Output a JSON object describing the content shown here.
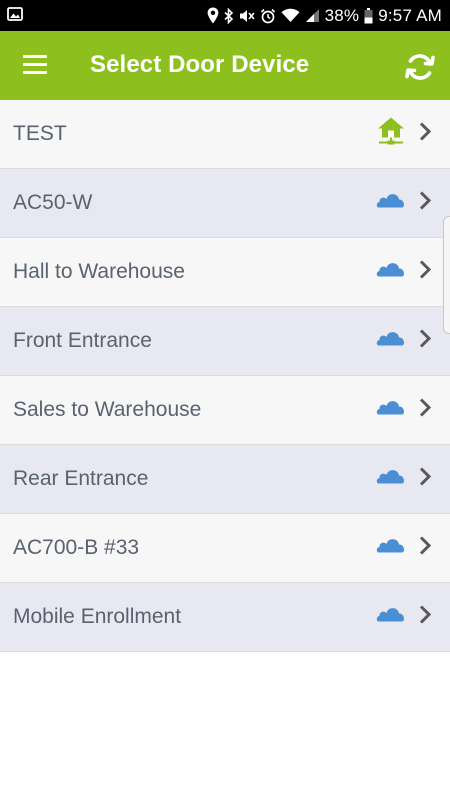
{
  "status_bar": {
    "battery": "38%",
    "time": "9:57 AM"
  },
  "app_bar": {
    "title": "Select Door Device"
  },
  "devices": [
    {
      "label": "TEST",
      "connection": "local-network-icon"
    },
    {
      "label": "AC50-W",
      "connection": "cloud-icon"
    },
    {
      "label": "Hall to Warehouse",
      "connection": "cloud-icon"
    },
    {
      "label": "Front Entrance",
      "connection": "cloud-icon"
    },
    {
      "label": "Sales to Warehouse",
      "connection": "cloud-icon"
    },
    {
      "label": "Rear Entrance",
      "connection": "cloud-icon"
    },
    {
      "label": "AC700-B #33",
      "connection": "cloud-icon"
    },
    {
      "label": "Mobile Enrollment",
      "connection": "cloud-icon"
    }
  ],
  "colors": {
    "app_bar": "#8dc01f",
    "cloud": "#4a8fd4",
    "home": "#8dc01f"
  }
}
